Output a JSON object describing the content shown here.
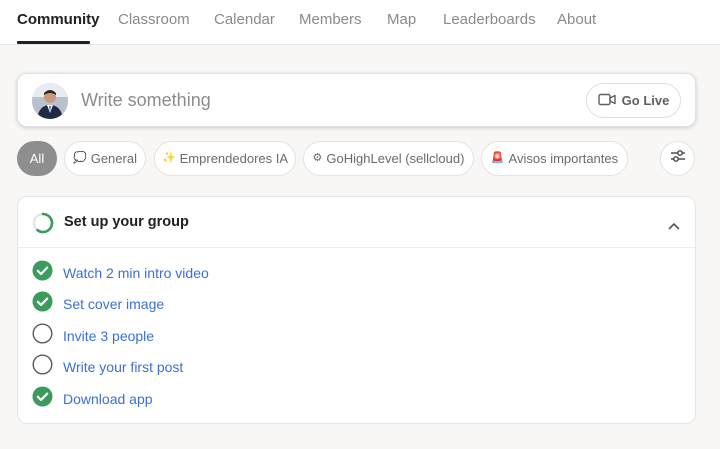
{
  "nav": {
    "tabs": [
      {
        "label": "Community",
        "active": true
      },
      {
        "label": "Classroom"
      },
      {
        "label": "Calendar"
      },
      {
        "label": "Members"
      },
      {
        "label": "Map"
      },
      {
        "label": "Leaderboards"
      },
      {
        "label": "About"
      }
    ]
  },
  "composer": {
    "placeholder": "Write something",
    "go_live_label": "Go Live",
    "go_live_icon": "video-camera-icon"
  },
  "filters": {
    "chips": [
      {
        "label": "All",
        "active": true,
        "emoji": ""
      },
      {
        "label": "General",
        "emoji": "💭"
      },
      {
        "label": "Emprendedores IA",
        "emoji": "✨"
      },
      {
        "label": "GoHighLevel (sellcloud)",
        "emoji": "⚙"
      },
      {
        "label": "Avisos importantes",
        "emoji": "🚨"
      }
    ],
    "settings_icon": "sliders-icon"
  },
  "setup": {
    "title": "Set up your group",
    "progress": 0.6,
    "tasks": [
      {
        "label": "Watch 2 min intro video",
        "done": true
      },
      {
        "label": "Set cover image",
        "done": true
      },
      {
        "label": "Invite 3 people",
        "done": false
      },
      {
        "label": "Write your first post",
        "done": false
      },
      {
        "label": "Download app",
        "done": true
      }
    ]
  },
  "colors": {
    "accent_green": "#3a9b5c",
    "link_blue": "#3b6fd4",
    "chip_active": "#8e8e8e",
    "text_dark": "#202124",
    "text_muted": "#8a8a8a"
  }
}
